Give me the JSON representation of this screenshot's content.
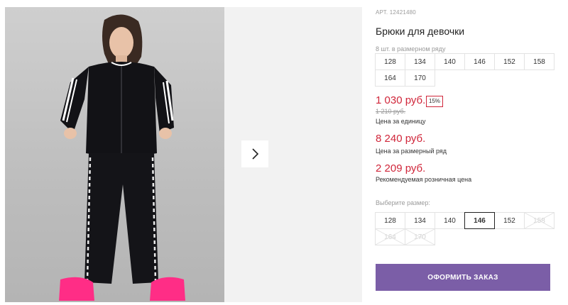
{
  "gallery": {
    "next_icon": "chevron-right-icon"
  },
  "product": {
    "sku": "АРТ. 12421480",
    "title": "Брюки для девочки",
    "pack_note": "8 шт. в размерном ряду",
    "pack_sizes": [
      "128",
      "134",
      "140",
      "146",
      "152",
      "158",
      "164",
      "170"
    ],
    "price": "1 030 руб.",
    "discount": "15%",
    "old_price": "1 210 руб.",
    "price_label": "Цена за единицу",
    "pack_price": "8 240 руб.",
    "pack_price_label": "Цена за размерный ряд",
    "retail_price": "2 209 руб.",
    "retail_price_label": "Рекомендуемая розничная цена"
  },
  "size_select": {
    "label": "Выберите размер:",
    "sizes": [
      {
        "value": "128",
        "state": "available"
      },
      {
        "value": "134",
        "state": "available"
      },
      {
        "value": "140",
        "state": "available"
      },
      {
        "value": "146",
        "state": "selected"
      },
      {
        "value": "152",
        "state": "available"
      },
      {
        "value": "158",
        "state": "unavailable"
      },
      {
        "value": "164",
        "state": "unavailable"
      },
      {
        "value": "170",
        "state": "unavailable"
      }
    ]
  },
  "actions": {
    "order_label": "ОФОРМИТЬ ЗАКАЗ"
  },
  "colors": {
    "price_red": "#d0263a",
    "button_purple": "#7b5ea7"
  }
}
